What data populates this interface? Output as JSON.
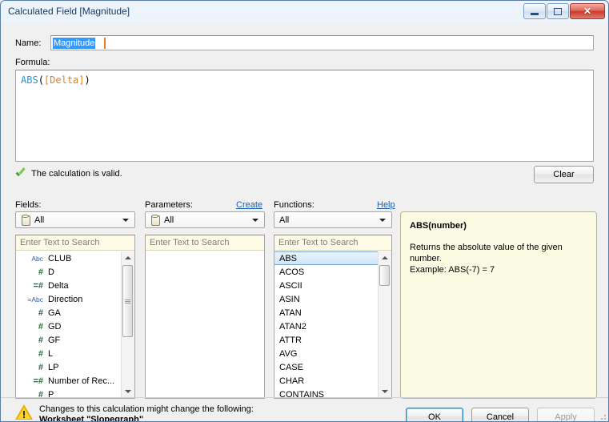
{
  "window": {
    "title": "Calculated Field [Magnitude]",
    "controls": {
      "minimize": "minimize",
      "restore": "restore",
      "close": "✕"
    }
  },
  "name_field": {
    "label": "Name:",
    "value": "Magnitude"
  },
  "formula": {
    "label": "Formula:",
    "tokens": {
      "function": "ABS",
      "open_paren": "(",
      "field": "[Delta]",
      "close_paren": ")"
    }
  },
  "validation": {
    "message": "The calculation is valid.",
    "icon": "green-check-icon"
  },
  "clear_button": "Clear",
  "fields_column": {
    "header": "Fields:",
    "dropdown": "All",
    "search_placeholder": "Enter Text to Search",
    "items": [
      {
        "icon": "Abc",
        "type": "string",
        "label": "CLUB"
      },
      {
        "icon": "#",
        "type": "number",
        "label": "D"
      },
      {
        "icon": "=#",
        "type": "number",
        "label": "Delta"
      },
      {
        "icon": "=Abc",
        "type": "string",
        "label": "Direction"
      },
      {
        "icon": "#",
        "type": "number",
        "label": "GA"
      },
      {
        "icon": "#",
        "type": "number",
        "label": "GD"
      },
      {
        "icon": "#",
        "type": "number",
        "label": "GF"
      },
      {
        "icon": "#",
        "type": "number",
        "label": "L"
      },
      {
        "icon": "#",
        "type": "number",
        "label": "LP"
      },
      {
        "icon": "=#",
        "type": "number",
        "label": "Number of Rec..."
      },
      {
        "icon": "#",
        "type": "number",
        "label": "P"
      }
    ]
  },
  "parameters_column": {
    "header": "Parameters:",
    "create_link": "Create",
    "dropdown": "All",
    "search_placeholder": "Enter Text to Search",
    "items": []
  },
  "functions_column": {
    "header": "Functions:",
    "help_link": "Help",
    "dropdown": "All",
    "search_placeholder": "Enter Text to Search",
    "selected": "ABS",
    "items": [
      "ABS",
      "ACOS",
      "ASCII",
      "ASIN",
      "ATAN",
      "ATAN2",
      "ATTR",
      "AVG",
      "CASE",
      "CHAR",
      "CONTAINS"
    ]
  },
  "help_panel": {
    "title": "ABS(number)",
    "description": "Returns the absolute value of the given number.",
    "example": "Example: ABS(-7) = 7"
  },
  "footer": {
    "warning_line1": "Changes to this calculation might change the following:",
    "warning_line2": "Worksheet \"Slopegraph\"",
    "ok": "OK",
    "cancel": "Cancel",
    "apply": "Apply"
  },
  "colors": {
    "accent_blue": "#3399ff",
    "function_token": "#2f93c8",
    "field_token": "#d98020",
    "valid_green": "#4f9c31",
    "warning_yellow": "#ffd633",
    "help_bg": "#fbfbe4"
  }
}
